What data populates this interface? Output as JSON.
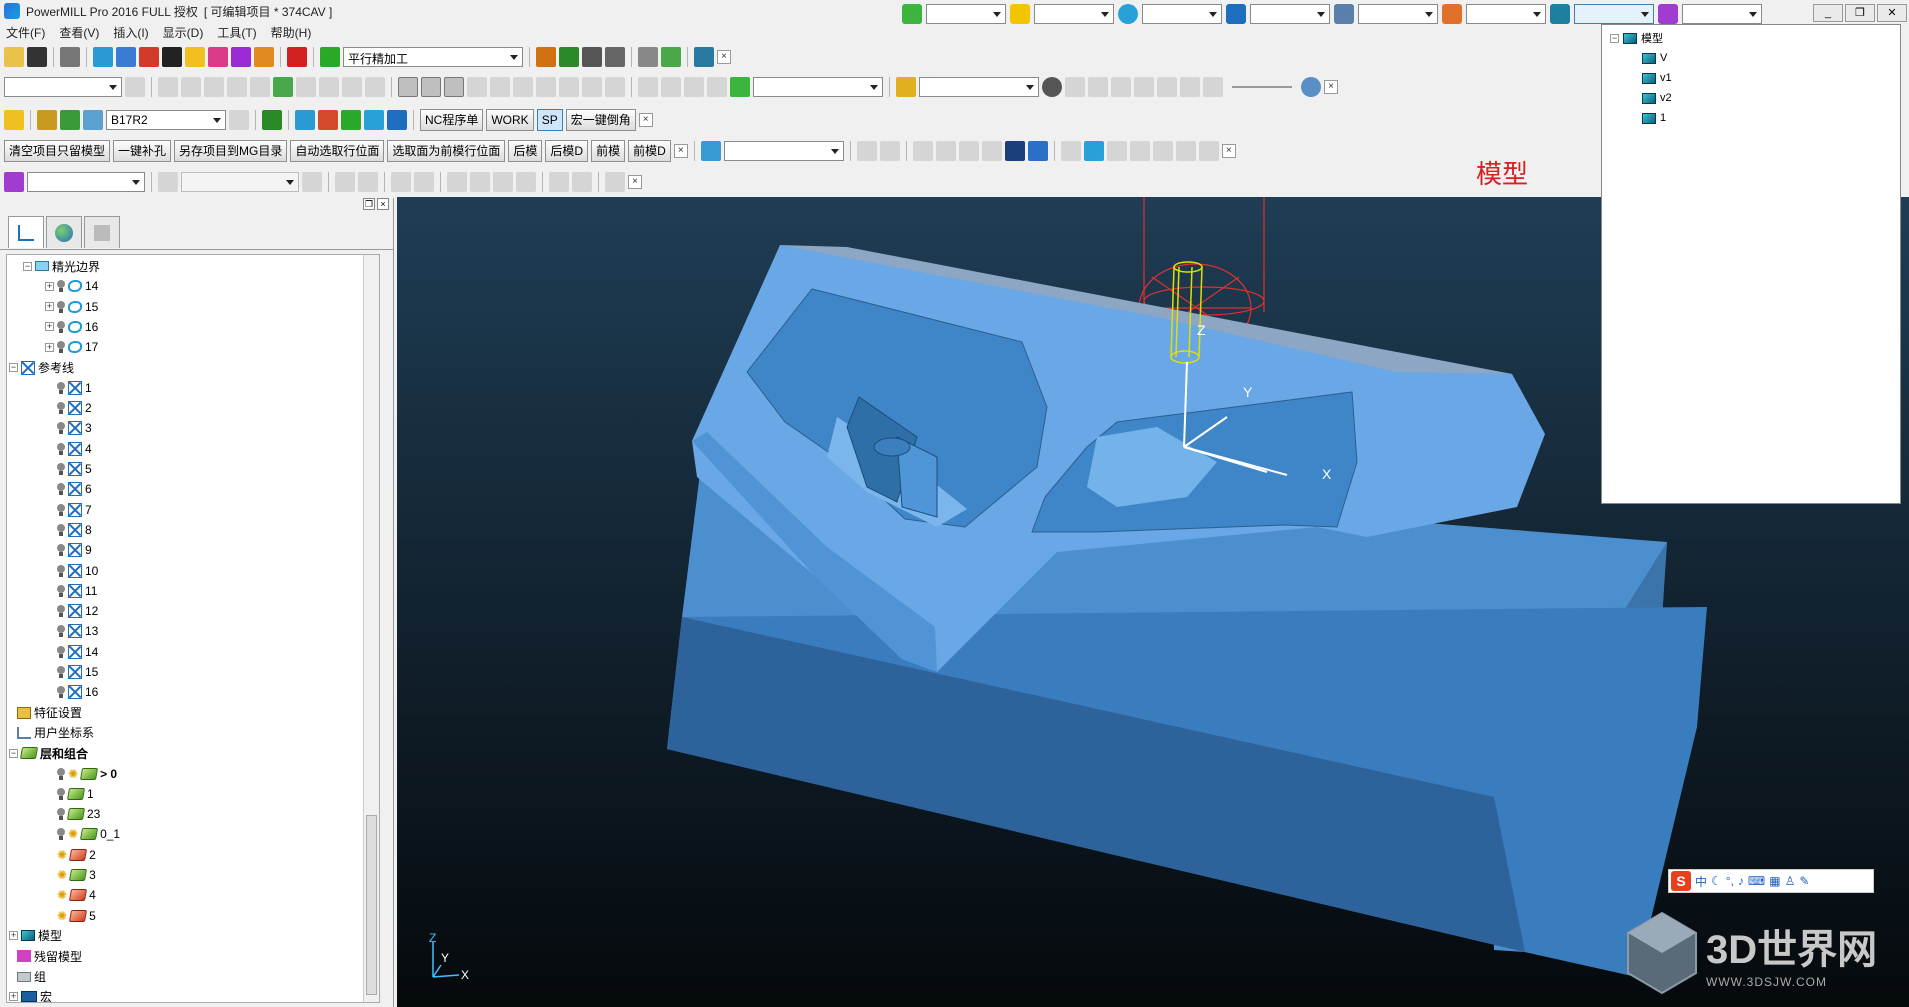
{
  "titlebar": {
    "title": "PowerMILL Pro 2016 FULL 授权",
    "project": "[ 可编辑项目 * 374CAV ]"
  },
  "menu": [
    "文件(F)",
    "查看(V)",
    "插入(I)",
    "显示(D)",
    "工具(T)",
    "帮助(H)"
  ],
  "toolbar": {
    "strategy_combo": "平行精加工",
    "tool_combo": "B17R2",
    "btn_nc": "NC程序单",
    "btn_work": "WORK",
    "btn_sp": "SP",
    "btn_macro": "宏一键倒角",
    "macros": [
      "清空项目只留模型",
      "一键补孔",
      "另存项目到MG目录",
      "自动选取行位面",
      "选取面为前模行位面",
      "后模",
      "后模D",
      "前模",
      "前模D"
    ]
  },
  "popup": {
    "root": "模型",
    "items": [
      "V",
      "v1",
      "v2",
      "1"
    ]
  },
  "model_label": "模型",
  "explorer": {
    "boundary_group": "精光边界",
    "boundaries": [
      "14",
      "15",
      "16",
      "17"
    ],
    "patterns_group": "参考线",
    "patterns": [
      "1",
      "2",
      "3",
      "4",
      "5",
      "6",
      "7",
      "8",
      "9",
      "10",
      "11",
      "12",
      "13",
      "14",
      "15",
      "16"
    ],
    "features": "特征设置",
    "workplanes": "用户坐标系",
    "layers_group": "层和组合",
    "layers": [
      "> 0",
      "1",
      "23",
      "0_1",
      "2",
      "3",
      "4",
      "5"
    ],
    "models": "模型",
    "stock_models": "残留模型",
    "groups": "组",
    "macros": "宏"
  },
  "axes": {
    "x": "X",
    "y": "Y",
    "z": "Z"
  },
  "ime": {
    "label": "中"
  },
  "watermark": {
    "text": "3D世界网",
    "url": "WWW.3DSJW.COM"
  },
  "colors": {
    "model": "#4aa3e6",
    "accent": "#d72020",
    "viewport_top": "#1f3d55"
  }
}
